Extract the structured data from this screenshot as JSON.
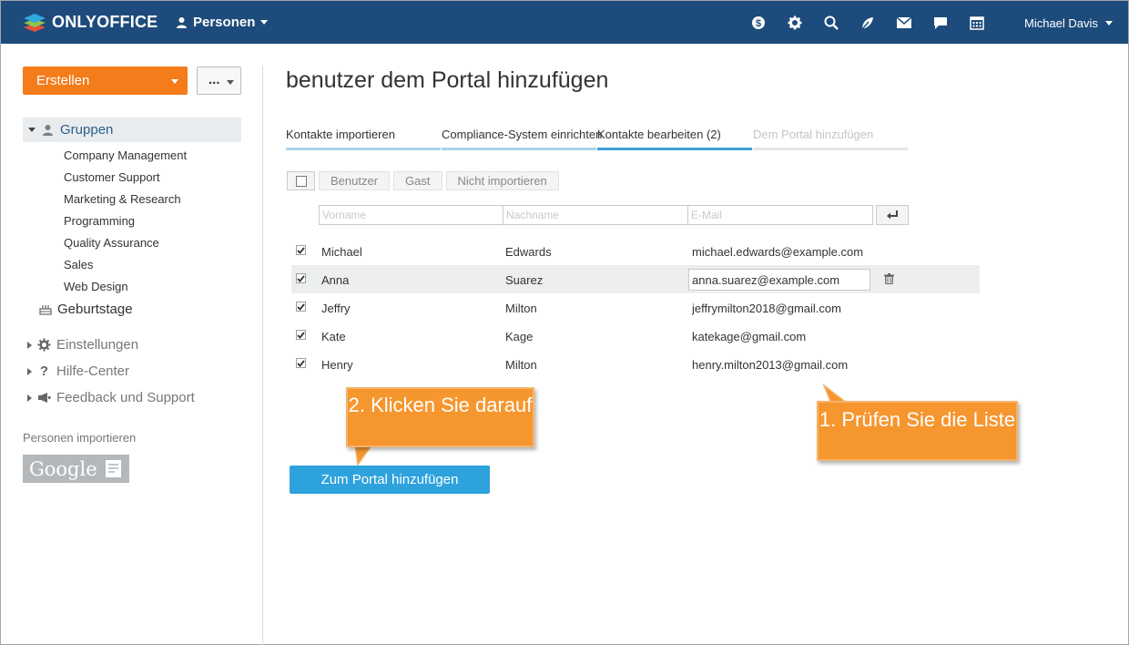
{
  "topbar": {
    "logo_text": "ONLYOFFICE",
    "module_label": "Personen",
    "icons": [
      "payment-icon",
      "settings-icon",
      "search-icon",
      "feed-icon",
      "mail-icon",
      "chat-icon",
      "calendar-icon"
    ],
    "user_name": "Michael Davis",
    "bg_color": "#1d4b7b"
  },
  "sidebar": {
    "create_label": "Erstellen",
    "more_label": "...",
    "groups_label": "Gruppen",
    "groups": [
      "Company Management",
      "Customer Support",
      "Marketing & Research",
      "Programming",
      "Quality Assurance",
      "Sales",
      "Web Design"
    ],
    "birthdays_label": "Geburtstage",
    "settings_label": "Einstellungen",
    "help_label": "Hilfe-Center",
    "feedback_label": "Feedback und Support",
    "import_label": "Personen importieren",
    "google_label": "Google",
    "create_color": "#f47c1b"
  },
  "main": {
    "title": "benutzer dem Portal hinzufügen",
    "steps": [
      "Kontakte importieren",
      "Compliance-System einrichten",
      "Kontakte bearbeiten (2)",
      "Dem Portal hinzufügen"
    ],
    "filters": [
      "Benutzer",
      "Gast",
      "Nicht importieren"
    ],
    "inputs": {
      "firstname_placeholder": "Vorname",
      "lastname_placeholder": "Nachname",
      "email_placeholder": "E-Mail"
    },
    "contacts": [
      {
        "first": "Michael",
        "last": "Edwards",
        "email": "michael.edwards@example.com"
      },
      {
        "first": "Anna",
        "last": "Suarez",
        "email": "anna.suarez@example.com"
      },
      {
        "first": "Jeffry",
        "last": "Milton",
        "email": "jeffrymilton2018@gmail.com"
      },
      {
        "first": "Kate",
        "last": "Kage",
        "email": "katekage@gmail.com"
      },
      {
        "first": "Henry",
        "last": "Milton",
        "email": "henry.milton2013@gmail.com"
      }
    ],
    "add_button_label": "Zum Portal hinzufügen",
    "accent_color": "#2ea2dd"
  },
  "callouts": {
    "click_here": "2. Klicken Sie darauf",
    "check_list": "1. Prüfen Sie die Liste",
    "color": "#f6962f"
  }
}
